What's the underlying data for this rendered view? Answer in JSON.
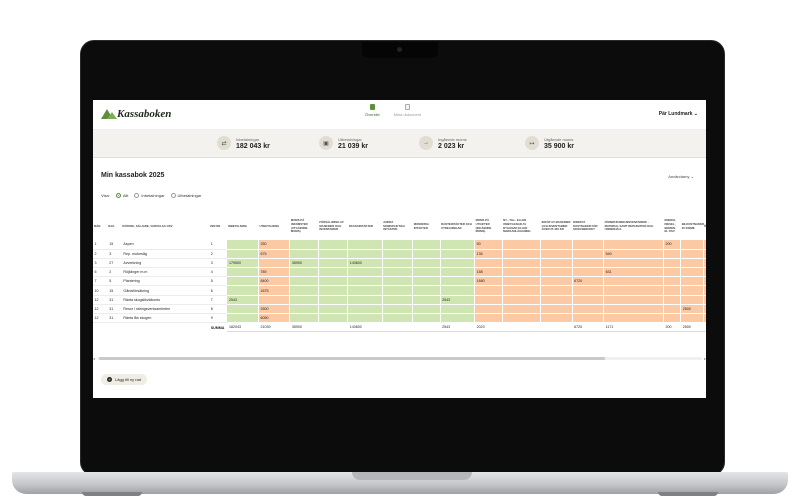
{
  "app": {
    "name": "Kassaboken",
    "nav": [
      {
        "label": "Översikt",
        "active": true
      },
      {
        "label": "Mina dokument",
        "active": false
      }
    ],
    "user": "Pär Lundmark ⌄"
  },
  "summary": [
    {
      "icon": "coins-in-icon",
      "label": "Inbetalningar",
      "value": "182 043 kr"
    },
    {
      "icon": "banknote-icon",
      "label": "Utbetalningar",
      "value": "21 039 kr"
    },
    {
      "icon": "arrow-in-icon",
      "label": "Ingående moms",
      "value": "2 023 kr"
    },
    {
      "icon": "arrow-out-icon",
      "label": "Utgående moms",
      "value": "35 900 kr"
    }
  ],
  "section": {
    "title": "Min kassabok 2025",
    "user_select": "Användarny ⌄"
  },
  "filters": {
    "label": "Visa:",
    "options": [
      {
        "label": "Allt",
        "checked": true
      },
      {
        "label": "Inbetalningar",
        "checked": false
      },
      {
        "label": "Utbetalningar",
        "checked": false
      }
    ]
  },
  "table": {
    "columns": [
      "MÅN",
      "DAG",
      "KÖPARE, SÄLJARE, VARUSLAG OSV",
      "VER NR",
      "INBETALNING",
      "UTBETALNING",
      "MOMS PÅ INKOMSTER (UTGÅENDE MOMS)",
      "FÖRSÄLJNING AV MASKINER OCH INVENTARIER",
      "SKOGSINTÄKTER",
      "ANDRA MOMSPLIKTIGA INTÄKTER",
      "MOMSFRIA INTÄKTER",
      "RÄNTEINTÄKTER OCH UTDELNINGAR",
      "MOMS PÅ UTGIFTER (INGÅENDE MOMS)",
      "NY-, TILL- ELLER OMBYGGNAD AV BYGGNAD ELLER MARKANLÄGGNING",
      "INKÖP AV MASKINER OCH INVENTARIER ÖVER 25 400 KR",
      "DIREKTA KOSTNADER FÖR SKOGSBRUKET",
      "FÖRBRUKNINGSINVENTARIER/ -MATERIAL SAMT REPARATION OCH UNDERHÅLL",
      "ENERGI, DIESEL, BENSIN, EL OSV",
      "BILKOSTNADER, 25 KR/MIL",
      "ÖVRI KOST"
    ],
    "rows": [
      [
        "1",
        "15",
        "Aspen",
        "1",
        "",
        "250",
        "",
        "",
        "",
        "",
        "",
        "",
        "50",
        "",
        "",
        "",
        "",
        "200",
        "",
        ""
      ],
      [
        "2",
        "3",
        "Rep. motorsåg",
        "2",
        "",
        "675",
        "",
        "",
        "",
        "",
        "",
        "",
        "135",
        "",
        "",
        "",
        "540",
        "",
        "",
        ""
      ],
      [
        "3",
        "27",
        "Avverkning",
        "3",
        "179500",
        "",
        "35900",
        "",
        "143600",
        "",
        "",
        "",
        "",
        "",
        "",
        "",
        "",
        "",
        "",
        ""
      ],
      [
        "6",
        "2",
        "Röjklinger m.m",
        "4",
        "",
        "789",
        "",
        "",
        "",
        "",
        "",
        "",
        "158",
        "",
        "",
        "",
        "631",
        "",
        "",
        ""
      ],
      [
        "7",
        "5",
        "Plantering",
        "5",
        "",
        "8400",
        "",
        "",
        "",
        "",
        "",
        "",
        "1680",
        "",
        "",
        "6720",
        "",
        "",
        "",
        ""
      ],
      [
        "10",
        "15",
        "Gårdsförsäkring",
        "6",
        "",
        "1675",
        "",
        "",
        "",
        "",
        "",
        "",
        "",
        "",
        "",
        "",
        "",
        "",
        "",
        ""
      ],
      [
        "12",
        "31",
        "Ränta skogslikvidkonto",
        "7",
        "2543",
        "",
        "",
        "",
        "",
        "",
        "",
        "2543",
        "",
        "",
        "",
        "",
        "",
        "",
        "",
        ""
      ],
      [
        "12",
        "31",
        "Resor i näringsverksamheten",
        "8",
        "",
        "2500",
        "",
        "",
        "",
        "",
        "",
        "",
        "",
        "",
        "",
        "",
        "",
        "",
        "2500",
        ""
      ],
      [
        "12",
        "31",
        "Ränta lån skogen",
        "9",
        "",
        "6050",
        "",
        "",
        "",
        "",
        "",
        "",
        "",
        "",
        "",
        "",
        "",
        "",
        "",
        ""
      ]
    ],
    "sum_row": [
      "",
      "",
      "",
      "SUMMA",
      "182043",
      "21039",
      "35900",
      "",
      "143600",
      "",
      "",
      "2543",
      "2023",
      "",
      "",
      "6720",
      "1171",
      "200",
      "2500",
      ""
    ]
  },
  "actions": {
    "add_row": "Lägg till ny rad"
  },
  "colors": {
    "income_cell": "#cfe6b2",
    "expense_cell": "#fbc9a4",
    "brand_green": "#5e8f3d"
  }
}
